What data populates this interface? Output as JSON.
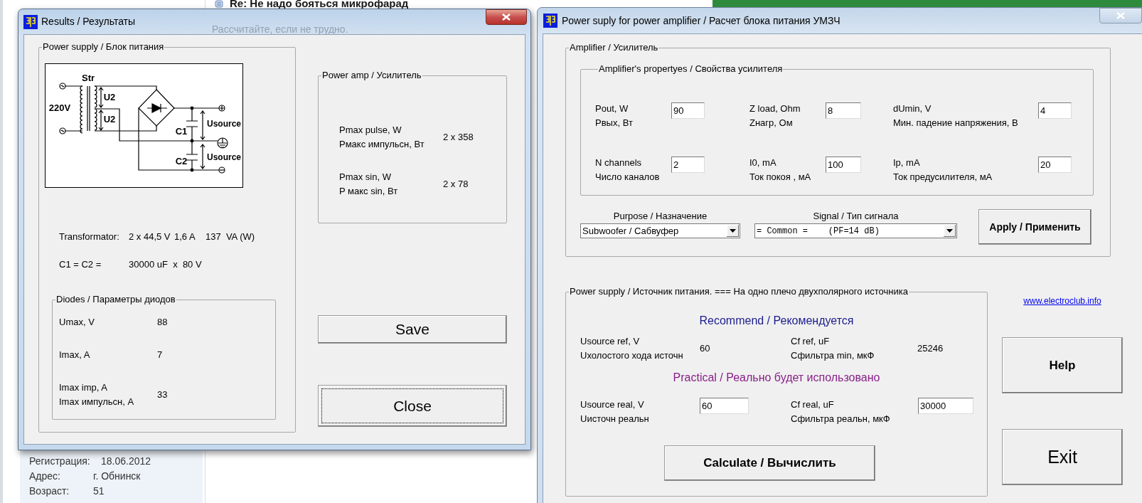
{
  "background": {
    "post_title": "Re: Не надо бояться микрофарад",
    "post_text": "Рассчитайте, если не трудно.",
    "profile": [
      {
        "label": "Регистрация:",
        "value": "18.06.2012"
      },
      {
        "label": "Адрес:",
        "value": "г. Обнинск"
      },
      {
        "label": "Возраст:",
        "value": "51"
      }
    ]
  },
  "results_window": {
    "title": "Results / Результаты",
    "active": true,
    "power_supply": {
      "title": "Power supply / Блок питания",
      "schematic_labels": [
        "Str",
        "220V",
        "U2",
        "U2",
        "C1",
        "C2",
        "Usource",
        "Usource"
      ],
      "transformator": {
        "label": "Transformator:",
        "values": [
          "2 x 44,5 V",
          "1,6 A",
          "137  VA (W)"
        ]
      },
      "capacitors": {
        "label": "C1 = C2 =",
        "value": "30000 uF  x  80 V"
      },
      "diodes": {
        "title": "Diodes / Параметры диодов",
        "rows": [
          {
            "labels": [
              "Umax, V"
            ],
            "value": "88"
          },
          {
            "labels": [
              "Imax, A"
            ],
            "value": "7"
          },
          {
            "labels": [
              "Imax imp, A",
              "Imax импульсн, A"
            ],
            "value": "33"
          }
        ]
      }
    },
    "power_amp": {
      "title": "Power amp / Усилитель",
      "rows": [
        {
          "labels": [
            "Pmax pulse, W",
            "Рмакс импульсн, Вт"
          ],
          "value": "2 x 358"
        },
        {
          "labels": [
            "Pmax sin, W",
            "P макс sin, Вт"
          ],
          "value": "2 x 78"
        }
      ]
    },
    "buttons": [
      {
        "label": "Save",
        "focused": false
      },
      {
        "label": "Close",
        "focused": true
      }
    ]
  },
  "calc_window": {
    "title": "Power suply for power amplifier / Расчет блока питания УМЗЧ",
    "active": false,
    "amplifier": {
      "title": "Amplifier / Усилитель",
      "properties": {
        "title": "Amplifier's propertyes / Свойства усилителя",
        "fields": [
          {
            "labels": [
              "Pout, W",
              "Рвых, Вт"
            ],
            "value": "90"
          },
          {
            "labels": [
              "Z load, Ohm",
              "Zнагр, Ом"
            ],
            "value": "8"
          },
          {
            "labels": [
              "dUmin, V",
              "Мин. падение напряжения, В"
            ],
            "value": "4"
          },
          {
            "labels": [
              "N channels",
              "Число каналов"
            ],
            "value": "2"
          },
          {
            "labels": [
              "I0, mA",
              "Ток покоя , мА"
            ],
            "value": "100"
          },
          {
            "labels": [
              "Ip, mA",
              "Ток предусилителя, мА"
            ],
            "value": "20"
          }
        ]
      },
      "purpose": {
        "label": "Purpose / Назначение",
        "value": "Subwoofer / Сабвуфер"
      },
      "signal": {
        "label": "Signal / Тип сигнала",
        "value": "= Common =    (PF=14 dB)"
      },
      "apply_button": "Apply / Применить"
    },
    "power_supply": {
      "title": "Power supply / Источник питания. ===  На одно плечо двухполярного источника",
      "recommend_heading": "Recommend / Рекомендуется",
      "reference": [
        {
          "labels": [
            "Usource ref, V",
            "Uхолостого хода источн"
          ],
          "value": "60"
        },
        {
          "labels": [
            "Cf ref, uF",
            "Сфильтра min, мкФ"
          ],
          "value": "25246"
        }
      ],
      "practical_heading": "Practical / Реально будет использовано",
      "practical": [
        {
          "labels": [
            "Usource real, V",
            "Uисточн реальн"
          ],
          "value": "60"
        },
        {
          "labels": [
            "Cf real, uF",
            "Сфильтра реальн, мкФ"
          ],
          "value": "30000"
        }
      ],
      "calculate_button": "Calculate / Вычислить"
    },
    "link": "www.electroclub.info",
    "help_button": "Help",
    "exit_button": "Exit"
  }
}
